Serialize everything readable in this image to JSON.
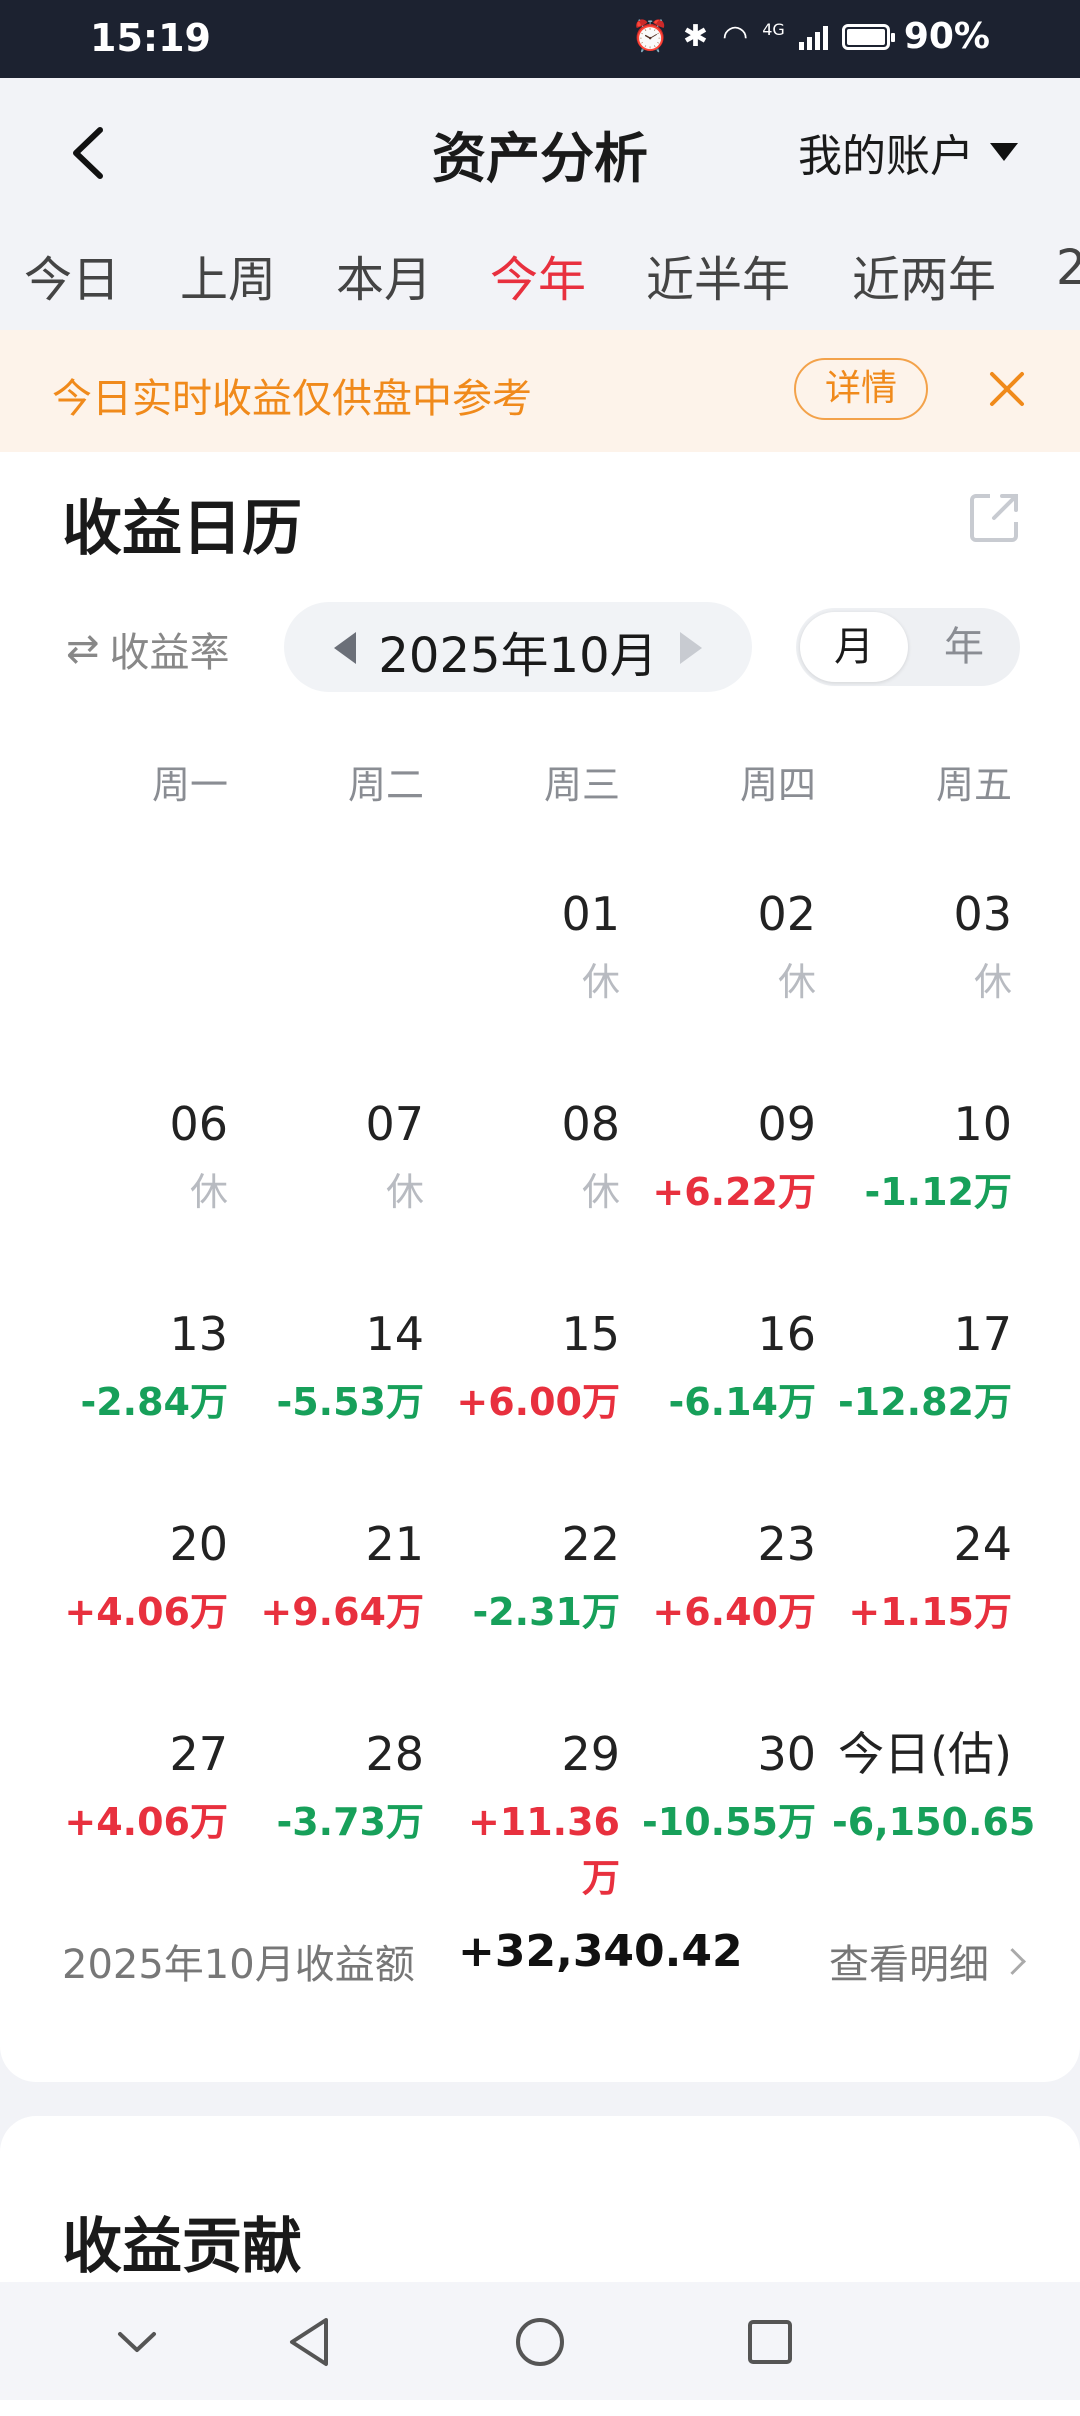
{
  "status_bar": {
    "time": "15:19",
    "network": "4G",
    "battery": "90%"
  },
  "header": {
    "title": "资产分析",
    "account": "我的账户"
  },
  "tabs": [
    {
      "label": "今日",
      "active": false
    },
    {
      "label": "上周",
      "active": false
    },
    {
      "label": "本月",
      "active": false
    },
    {
      "label": "今年",
      "active": true
    },
    {
      "label": "近半年",
      "active": false
    },
    {
      "label": "近两年",
      "active": false
    },
    {
      "label": "2",
      "active": false
    }
  ],
  "notice": {
    "text": "今日实时收益仅供盘中参考",
    "detail_label": "详情"
  },
  "calendar": {
    "title": "收益日历",
    "rate_toggle": "收益率",
    "month": "2025年10月",
    "seg_month": "月",
    "seg_year": "年",
    "weekdays": [
      "周一",
      "周二",
      "周三",
      "周四",
      "周五"
    ],
    "weeks": [
      [
        null,
        null,
        {
          "day": "01",
          "value": "休",
          "type": "rest"
        },
        {
          "day": "02",
          "value": "休",
          "type": "rest"
        },
        {
          "day": "03",
          "value": "休",
          "type": "rest"
        }
      ],
      [
        {
          "day": "06",
          "value": "休",
          "type": "rest"
        },
        {
          "day": "07",
          "value": "休",
          "type": "rest"
        },
        {
          "day": "08",
          "value": "休",
          "type": "rest"
        },
        {
          "day": "09",
          "value": "+6.22万",
          "type": "pos"
        },
        {
          "day": "10",
          "value": "-1.12万",
          "type": "neg"
        }
      ],
      [
        {
          "day": "13",
          "value": "-2.84万",
          "type": "neg"
        },
        {
          "day": "14",
          "value": "-5.53万",
          "type": "neg"
        },
        {
          "day": "15",
          "value": "+6.00万",
          "type": "pos"
        },
        {
          "day": "16",
          "value": "-6.14万",
          "type": "neg"
        },
        {
          "day": "17",
          "value": "-12.82万",
          "type": "neg"
        }
      ],
      [
        {
          "day": "20",
          "value": "+4.06万",
          "type": "pos"
        },
        {
          "day": "21",
          "value": "+9.64万",
          "type": "pos"
        },
        {
          "day": "22",
          "value": "-2.31万",
          "type": "neg"
        },
        {
          "day": "23",
          "value": "+6.40万",
          "type": "pos"
        },
        {
          "day": "24",
          "value": "+1.15万",
          "type": "pos"
        }
      ],
      [
        {
          "day": "27",
          "value": "+4.06万",
          "type": "pos"
        },
        {
          "day": "28",
          "value": "-3.73万",
          "type": "neg"
        },
        {
          "day": "29",
          "value": "+11.36万",
          "type": "pos"
        },
        {
          "day": "30",
          "value": "-10.55万",
          "type": "neg"
        },
        {
          "day": "今日(估)",
          "value": "-6,150.65",
          "type": "neg"
        }
      ]
    ],
    "summary_label": "2025年10月收益额",
    "summary_value": "+32,340.42",
    "view_detail": "查看明细"
  },
  "contribution": {
    "title": "收益贡献"
  },
  "colors": {
    "positive": "#e8303e",
    "negative": "#17a05a",
    "accent": "#f08a1b"
  }
}
